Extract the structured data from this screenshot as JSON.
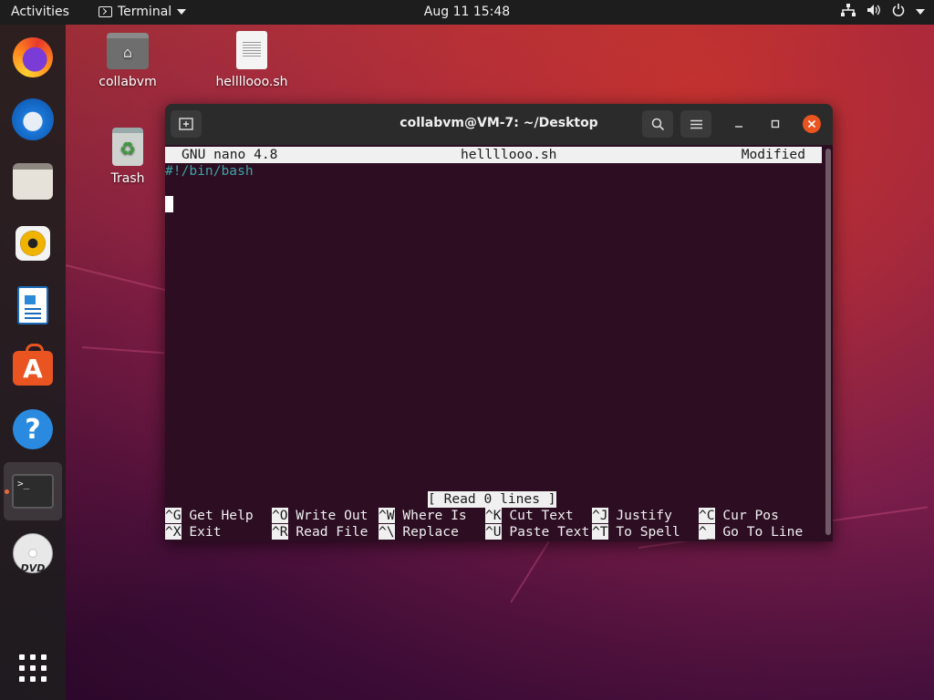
{
  "topbar": {
    "activities": "Activities",
    "app_name": "Terminal",
    "clock": "Aug 11  15:48"
  },
  "dock": {
    "items": [
      {
        "name": "Firefox",
        "icon": "firefox-icon"
      },
      {
        "name": "Thunderbird",
        "icon": "thunderbird-icon"
      },
      {
        "name": "Files",
        "icon": "files-icon"
      },
      {
        "name": "Rhythmbox",
        "icon": "rhythmbox-icon"
      },
      {
        "name": "LibreOffice Writer",
        "icon": "writer-icon"
      },
      {
        "name": "Ubuntu Software",
        "icon": "software-icon"
      },
      {
        "name": "Help",
        "icon": "help-icon"
      },
      {
        "name": "Terminal",
        "icon": "terminal-icon",
        "active": true
      },
      {
        "name": "DVD",
        "icon": "dvd-icon"
      },
      {
        "name": "Show Applications",
        "icon": "app-grid-icon"
      }
    ],
    "terminal_glyph": ">_",
    "dvd_label": "DVD",
    "help_glyph": "?",
    "store_glyph": "A"
  },
  "desktop": {
    "icons": [
      {
        "label": "collabvm",
        "type": "home-folder"
      },
      {
        "label": "hellllooo.sh",
        "type": "text-file"
      },
      {
        "label": "Trash",
        "type": "trash"
      }
    ]
  },
  "window": {
    "title": "collabvm@VM-7: ~/Desktop"
  },
  "nano": {
    "version": "GNU nano 4.8",
    "filename": "hellllooo.sh",
    "state": "Modified",
    "line1": "#!/bin/bash",
    "status": "[ Read 0 lines ]",
    "shortcuts_row1": [
      {
        "key": "^G",
        "label": "Get Help"
      },
      {
        "key": "^O",
        "label": "Write Out"
      },
      {
        "key": "^W",
        "label": "Where Is"
      },
      {
        "key": "^K",
        "label": "Cut Text"
      },
      {
        "key": "^J",
        "label": "Justify"
      },
      {
        "key": "^C",
        "label": "Cur Pos"
      }
    ],
    "shortcuts_row2": [
      {
        "key": "^X",
        "label": "Exit"
      },
      {
        "key": "^R",
        "label": "Read File"
      },
      {
        "key": "^\\",
        "label": "Replace"
      },
      {
        "key": "^U",
        "label": "Paste Text"
      },
      {
        "key": "^T",
        "label": "To Spell"
      },
      {
        "key": "^_",
        "label": "Go To Line"
      }
    ]
  },
  "colors": {
    "accent": "#e95420",
    "terminal_bg": "#2c0d22",
    "comment": "#3aa6a6"
  }
}
